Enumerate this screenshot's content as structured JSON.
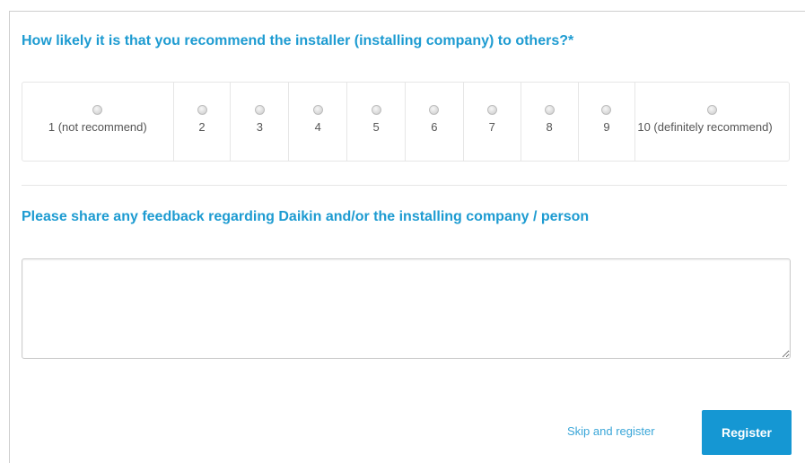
{
  "question": {
    "title": "How likely it is that you recommend the installer (installing company) to others?*",
    "options": [
      {
        "label": "1 (not recommend)"
      },
      {
        "label": "2"
      },
      {
        "label": "3"
      },
      {
        "label": "4"
      },
      {
        "label": "5"
      },
      {
        "label": "6"
      },
      {
        "label": "7"
      },
      {
        "label": "8"
      },
      {
        "label": "9"
      },
      {
        "label": "10 (definitely recommend)"
      }
    ],
    "selected": null
  },
  "feedback": {
    "title": "Please share any feedback regarding Daikin and/or the installing company / person",
    "value": "",
    "placeholder": ""
  },
  "actions": {
    "skip_label": "Skip and register",
    "register_label": "Register"
  },
  "colors": {
    "accent": "#1d9bd1",
    "button": "#1597d3",
    "link": "#3aa6d8"
  }
}
